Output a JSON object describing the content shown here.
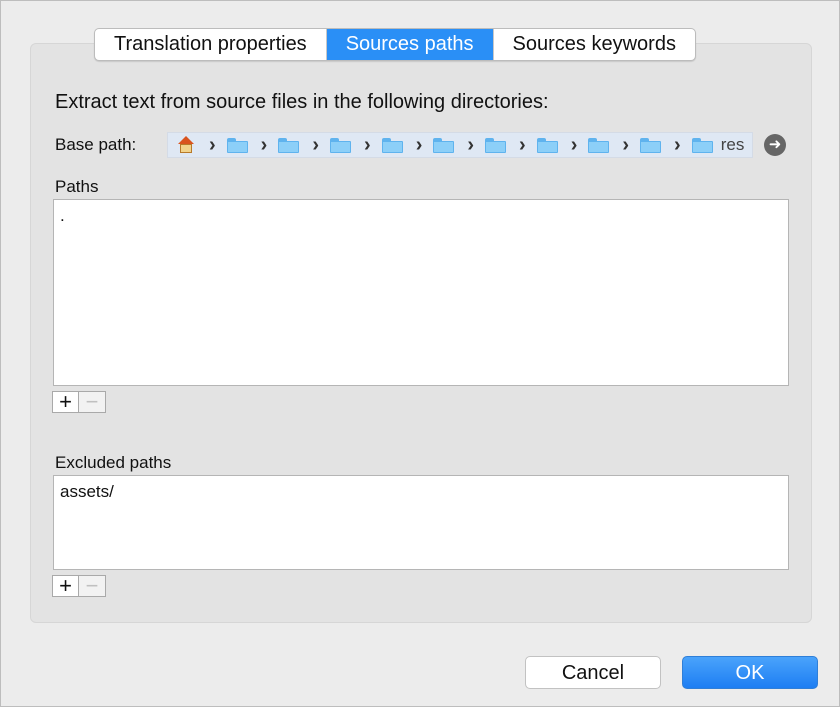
{
  "tabs": [
    {
      "label": "Translation properties",
      "active": false
    },
    {
      "label": "Sources paths",
      "active": true
    },
    {
      "label": "Sources keywords",
      "active": false
    }
  ],
  "heading": "Extract text from source files in the following directories:",
  "base_path": {
    "label": "Base path:",
    "crumbs": [
      "home-icon",
      "folder-icon",
      "folder-icon",
      "folder-icon",
      "folder-icon",
      "folder-icon",
      "folder-icon",
      "folder-icon",
      "folder-icon",
      "folder-icon",
      "folder-icon"
    ],
    "last_text": "res"
  },
  "paths": {
    "label": "Paths",
    "items": [
      "."
    ]
  },
  "excluded": {
    "label": "Excluded paths",
    "items": [
      "assets/"
    ]
  },
  "controls": {
    "add": "+",
    "remove": "−"
  },
  "buttons": {
    "cancel": "Cancel",
    "ok": "OK"
  },
  "colors": {
    "accent": "#2a8ff6",
    "folder": "#8ccff8"
  }
}
